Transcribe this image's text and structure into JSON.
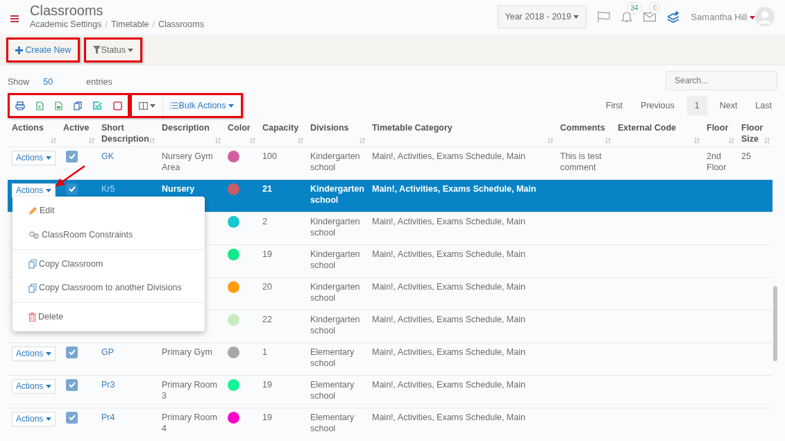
{
  "header": {
    "title": "Classrooms",
    "breadcrumb": [
      "Academic Settings",
      "Timetable",
      "Classrooms"
    ],
    "breadcrumb_separator": "/",
    "year": "Year 2018 - 2019",
    "notifications": "34",
    "messages": "0",
    "user": "Samantha Hill"
  },
  "toolbar": [
    {
      "kind": "create",
      "label": "Create New",
      "highlighted": true
    },
    {
      "kind": "filter",
      "label": "Status",
      "highlighted": true
    }
  ],
  "length": {
    "label": "Show",
    "value": "50",
    "suffix": "entries"
  },
  "search": {
    "placeholder": "Search..."
  },
  "export_group": {
    "highlighted": true
  },
  "bulk_group": {
    "highlighted": true,
    "bulk_label": "Bulk Actions"
  },
  "pagination": [
    {
      "label": "First",
      "selected": false
    },
    {
      "label": "Previous",
      "selected": false
    },
    {
      "label": "1",
      "selected": true
    },
    {
      "label": "Next",
      "selected": false
    },
    {
      "label": "Last",
      "selected": false
    }
  ],
  "table": {
    "columns": [
      "Actions",
      "Active",
      "Short Description",
      "Description",
      "Color",
      "Capacity",
      "Divisions",
      "Timetable Category",
      "Comments",
      "External Code",
      "Floor",
      "Floor Size"
    ],
    "rows": [
      {
        "selected": false,
        "action": "Actions",
        "active": true,
        "short": "GK",
        "description": "Nursery Gym Area",
        "color": "#d45f9e",
        "capacity": "100",
        "divisions": "Kindergarten school",
        "category": "Main!, Activities, Exams Schedule, Main",
        "comments": "This is test comment",
        "floor": "2nd Floor",
        "floor_size": "25"
      },
      {
        "selected": true,
        "pointed": true,
        "action": "Actions",
        "active": true,
        "short": "Kr5",
        "description": "Nursery",
        "color": "#cc5c63",
        "capacity": "21",
        "divisions": "Kindergarten school",
        "category": "Main!, Activities, Exams Schedule, Main"
      },
      {
        "selected": false,
        "color": "#17c9d1",
        "capacity": "2",
        "divisions": "Kindergarten school",
        "category": "Main!, Activities, Exams Schedule, Main"
      },
      {
        "selected": false,
        "color": "#12e98b",
        "capacity": "19",
        "divisions": "Kindergarten school",
        "category": "Main!, Activities, Exams Schedule, Main"
      },
      {
        "selected": false,
        "color": "#fd9c0f",
        "capacity": "20",
        "divisions": "Kindergarten school",
        "category": "Main!, Activities, Exams Schedule, Main"
      },
      {
        "selected": false,
        "color": "#c9ebbd",
        "capacity": "22",
        "divisions": "Kindergarten school",
        "category": "Main!, Activities, Exams Schedule, Main"
      },
      {
        "selected": false,
        "action": "Actions",
        "active": true,
        "short": "GP",
        "description": "Primary Gym",
        "color": "#a7a7a7",
        "capacity": "1",
        "divisions": "Elementary school",
        "category": "Main!, Activities, Exams Schedule, Main"
      },
      {
        "selected": false,
        "action": "Actions",
        "active": true,
        "short": "Pr3",
        "description": "Primary Room 3",
        "color": "#13f597",
        "capacity": "19",
        "divisions": "Elementary school",
        "category": "Main!, Activities, Exams Schedule, Main"
      },
      {
        "selected": false,
        "action": "Actions",
        "active": true,
        "short": "Pr4",
        "description": "Primary Room 4",
        "color": "#fc06c6",
        "capacity": "19",
        "divisions": "Elementary school",
        "category": "Main!, Activities, Exams Schedule, Main"
      }
    ]
  },
  "dropdown": {
    "groups": [
      [
        {
          "kind": "edit",
          "label": "Edit"
        },
        {
          "kind": "constraints",
          "label": "ClassRoom Constraints"
        }
      ],
      [
        {
          "kind": "copy",
          "label": "Copy Classroom"
        },
        {
          "kind": "copy",
          "label": "Copy Classroom to another Divisions"
        }
      ],
      [
        {
          "kind": "delete",
          "label": "Delete"
        }
      ]
    ]
  }
}
